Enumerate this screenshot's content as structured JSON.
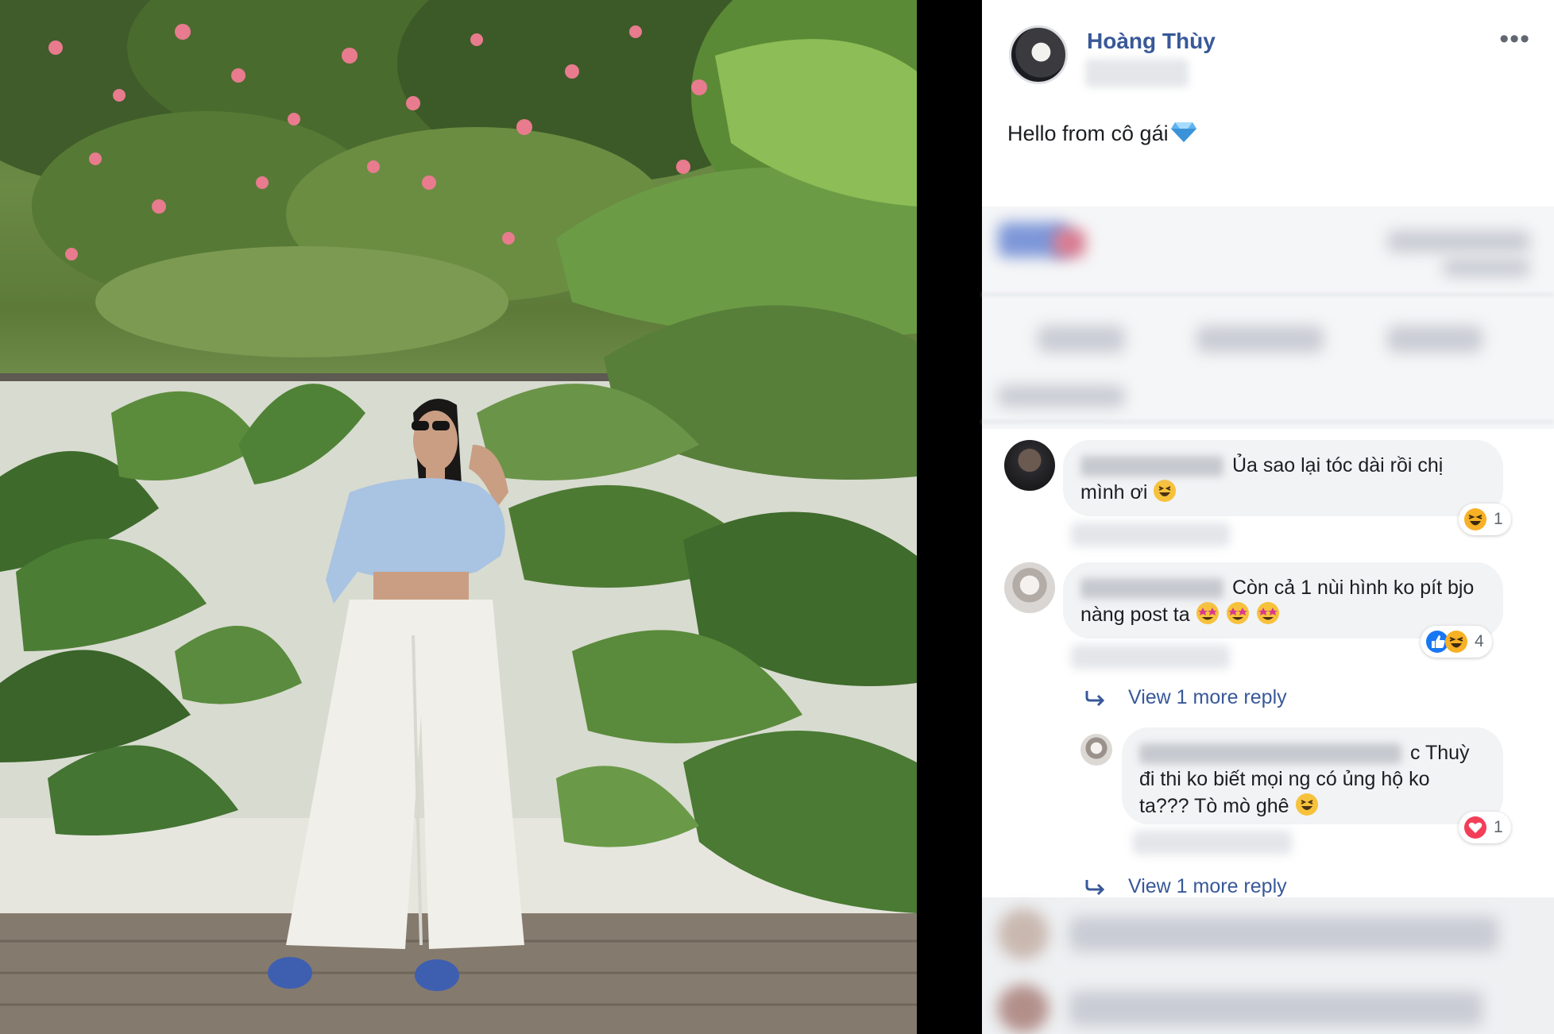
{
  "post": {
    "author": "Hoàng Thùy",
    "text": "Hello from cô gái",
    "more_icon": "more-horizontal-icon"
  },
  "comments": [
    {
      "text_line1": "Ủa sao lại tóc dài rồi chị",
      "text_line2": "mình ơi",
      "reaction": {
        "icon": "haha-reaction-icon",
        "count": "1"
      }
    },
    {
      "text_line1": "Còn cả 1 nùi hình ko pít bjo",
      "text_line2": "nàng post ta",
      "reaction": {
        "icons": [
          "like-reaction-icon",
          "haha-reaction-icon"
        ],
        "count": "4"
      }
    }
  ],
  "view_replies_1": "View 1 more reply",
  "reply": {
    "text_line1": "c Thuỳ",
    "text_line2": "đi thi ko biết mọi ng có ủng hộ ko",
    "text_line3": "ta??? Tò mò ghê",
    "reaction": {
      "icon": "love-reaction-icon",
      "count": "1"
    }
  },
  "view_replies_2": "View 1 more reply",
  "colors": {
    "link_blue": "#385898",
    "bubble_bg": "#f2f3f5",
    "text": "#1c1e21",
    "like_blue": "#1877f2",
    "love_red": "#f33e58",
    "haha_yellow": "#f7b125"
  }
}
